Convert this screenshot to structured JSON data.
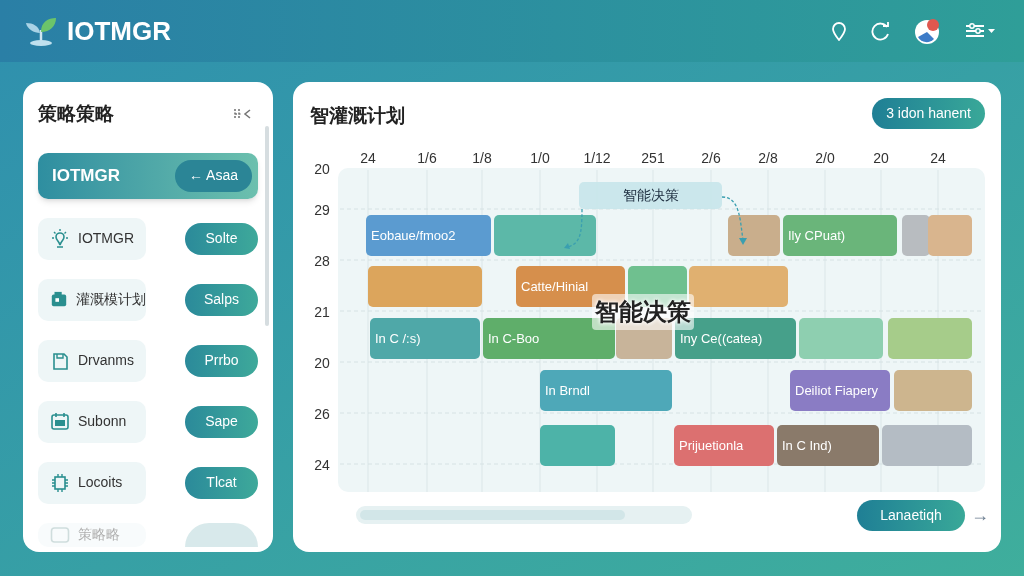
{
  "app": {
    "title": "IOTMGR"
  },
  "sidebar": {
    "title": "策略策略",
    "items": [
      {
        "label": "IOTMGR",
        "action": "← Asaa",
        "selected": true
      },
      {
        "label": "IOTMGR",
        "action": "Solte",
        "selected": false
      },
      {
        "label": "灌溉模计划",
        "action": "Salps",
        "selected": false
      },
      {
        "label": "Drvanms",
        "action": "Prrbo",
        "selected": false
      },
      {
        "label": "Subonn",
        "action": "Sape",
        "selected": false
      },
      {
        "label": "Locoits",
        "action": "Tlcat",
        "selected": false
      },
      {
        "label": "策略略",
        "selected": false
      }
    ]
  },
  "plan": {
    "title": "智灌溉计划",
    "action": "3 idon hanent",
    "columns": [
      "24",
      "1/6",
      "1/8",
      "1/0",
      "1/12",
      "251",
      "2/6",
      "2/8",
      "2/0",
      "20",
      "24"
    ],
    "rows": [
      "20",
      "29",
      "28",
      "21",
      "20",
      "26",
      "24"
    ],
    "lanes": [
      {
        "tasks": [
          {
            "label": "Eobaue/fmoo2",
            "color": "#5b9bd0"
          },
          {
            "color": "#5cb8a8"
          },
          {
            "color": "#c9ae8c"
          },
          {
            "label": "Ily CPuat)",
            "color": "#6ab57a"
          },
          {
            "color": "#b8bcc0"
          },
          {
            "color": "#d9b58e"
          }
        ]
      },
      {
        "tasks": [
          {
            "color": "#dca55c"
          },
          {
            "label": "Catte/Hinial",
            "color": "#d68f4c"
          },
          {
            "color": "#6fc08f"
          },
          {
            "color": "#e0b070"
          }
        ]
      },
      {
        "tasks": [
          {
            "label": "In C /:s)",
            "color": "#4fa8a8"
          },
          {
            "label": "In C-Boo",
            "color": "#5fae6a"
          },
          {
            "color": "#c8b49a"
          },
          {
            "label": "Iny Ce((catea)",
            "color": "#46a08a"
          },
          {
            "color": "#8ecfb0"
          },
          {
            "color": "#a6cc8a"
          }
        ]
      },
      {
        "tasks": [
          {
            "label": "In Brndl",
            "color": "#4ea8b8"
          },
          {
            "label": "Deiliot Fiapery",
            "color": "#8a7cc4"
          },
          {
            "color": "#cdb58e"
          }
        ]
      },
      {
        "tasks": [
          {
            "color": "#4db3a8"
          },
          {
            "label": "Prijuetionla",
            "color": "#dc7070"
          },
          {
            "label": "In C Ind)",
            "color": "#8a7a6a"
          },
          {
            "color": "#b4bcc4"
          }
        ]
      }
    ],
    "callout": "智能决策",
    "overlay": "智能决策",
    "footer_action": "Lanaetiqh",
    "next": "→"
  }
}
